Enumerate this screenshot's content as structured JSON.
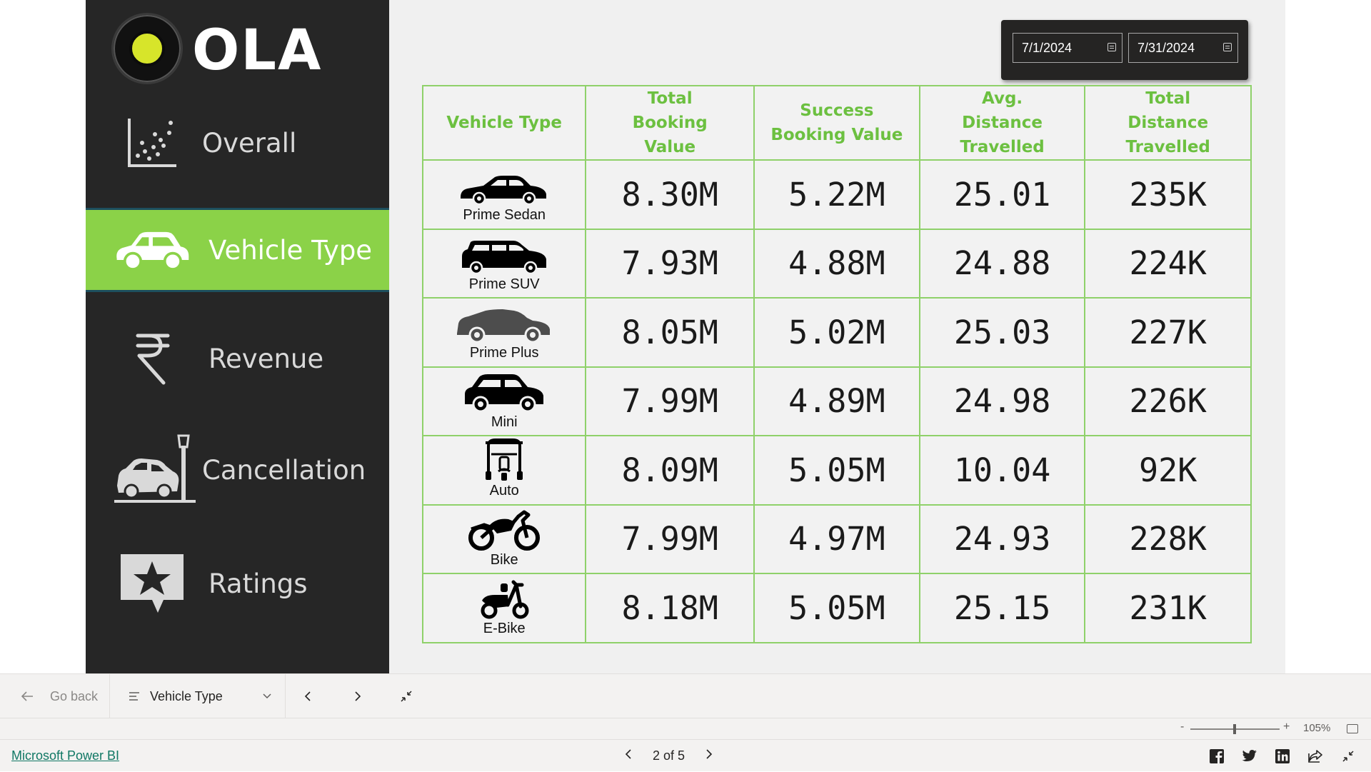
{
  "brand": {
    "logo_text": "OLA"
  },
  "sidebar": {
    "items": [
      {
        "label": "Overall",
        "icon": "scatter-chart-icon"
      },
      {
        "label": "Vehicle Type",
        "icon": "car-icon",
        "active": true
      },
      {
        "label": "Revenue",
        "icon": "rupee-icon"
      },
      {
        "label": "Cancellation",
        "icon": "car-crash-icon"
      },
      {
        "label": "Ratings",
        "icon": "star-comment-icon"
      }
    ]
  },
  "date_slicer": {
    "start": "7/1/2024",
    "end": "7/31/2024"
  },
  "table": {
    "headers": [
      "Vehicle Type",
      "Total Booking Value",
      "Success Booking Value",
      "Avg. Distance Travelled",
      "Total Distance Travelled"
    ],
    "rows": [
      {
        "vehicle": "Prime Sedan",
        "total_booking": "8.30M",
        "success_booking": "5.22M",
        "avg_distance": "25.01",
        "total_distance": "235K"
      },
      {
        "vehicle": "Prime SUV",
        "total_booking": "7.93M",
        "success_booking": "4.88M",
        "avg_distance": "24.88",
        "total_distance": "224K"
      },
      {
        "vehicle": "Prime Plus",
        "total_booking": "8.05M",
        "success_booking": "5.02M",
        "avg_distance": "25.03",
        "total_distance": "227K"
      },
      {
        "vehicle": "Mini",
        "total_booking": "7.99M",
        "success_booking": "4.89M",
        "avg_distance": "24.98",
        "total_distance": "226K"
      },
      {
        "vehicle": "Auto",
        "total_booking": "8.09M",
        "success_booking": "5.05M",
        "avg_distance": "10.04",
        "total_distance": "92K"
      },
      {
        "vehicle": "Bike",
        "total_booking": "7.99M",
        "success_booking": "4.97M",
        "avg_distance": "24.93",
        "total_distance": "228K"
      },
      {
        "vehicle": "E-Bike",
        "total_booking": "8.18M",
        "success_booking": "5.05M",
        "avg_distance": "25.15",
        "total_distance": "231K"
      }
    ]
  },
  "navbar": {
    "go_back": "Go back",
    "page_select": "Vehicle Type"
  },
  "zoom": {
    "level": "105%",
    "minus": "-",
    "plus": "+"
  },
  "footer": {
    "link": "Microsoft Power BI",
    "pager": "2 of 5"
  },
  "colors": {
    "accent_green": "#8bd248",
    "header_green": "#6cc040",
    "sidebar_bg": "#262626"
  }
}
